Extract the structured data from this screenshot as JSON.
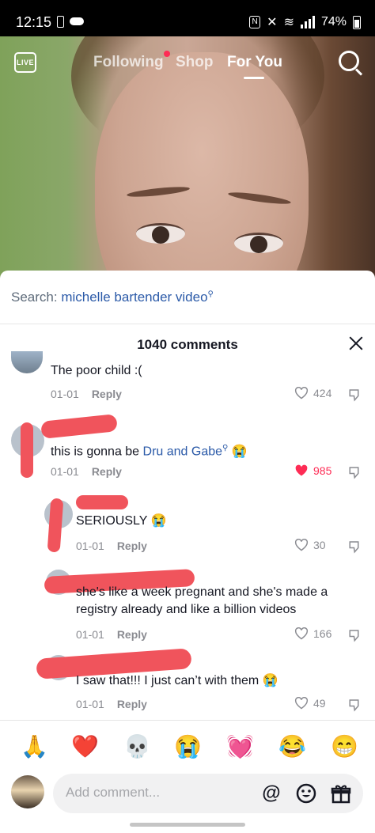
{
  "status_bar": {
    "time": "12:15",
    "battery": "74%"
  },
  "top_nav": {
    "live_label": "LIVE",
    "tabs": [
      {
        "label": "Following",
        "active": false,
        "has_dot": true
      },
      {
        "label": "Shop",
        "active": false
      },
      {
        "label": "For You",
        "active": true
      }
    ]
  },
  "comments_sheet": {
    "search_prefix": "Search:",
    "search_query": "michelle bartender video",
    "count_label": "1040 comments",
    "comments": [
      {
        "text": "The poor child :(",
        "date": "01-01",
        "reply": "Reply",
        "likes": "424",
        "liked": false
      },
      {
        "text": "this is gonna be",
        "mention": "Dru and Gabe",
        "emoji": "😭",
        "date": "01-01",
        "reply": "Reply",
        "likes": "985",
        "liked": true
      },
      {
        "text": "SERIOUSLY",
        "emoji": "😭",
        "date": "01-01",
        "reply": "Reply",
        "likes": "30",
        "liked": false
      },
      {
        "text_line1": "she's like a week pregnant and she's made a",
        "text_line2": "registry already and like a billion videos",
        "date": "01-01",
        "reply": "Reply",
        "likes": "166",
        "liked": false
      },
      {
        "text": "I saw that!!! I just can’t with them",
        "emoji": "😭",
        "date": "01-01",
        "reply": "Reply",
        "likes": "49",
        "liked": false
      }
    ],
    "quick_emojis": [
      "🙏",
      "❤️",
      "💀",
      "😭",
      "💓",
      "😂",
      "😁"
    ],
    "composer": {
      "placeholder": "Add comment...",
      "at_symbol": "@"
    }
  },
  "colors": {
    "accent_red": "#fe2c55",
    "link_blue": "#2b5aa8",
    "redaction": "#f0545c",
    "muted_text": "#8a8b91"
  }
}
